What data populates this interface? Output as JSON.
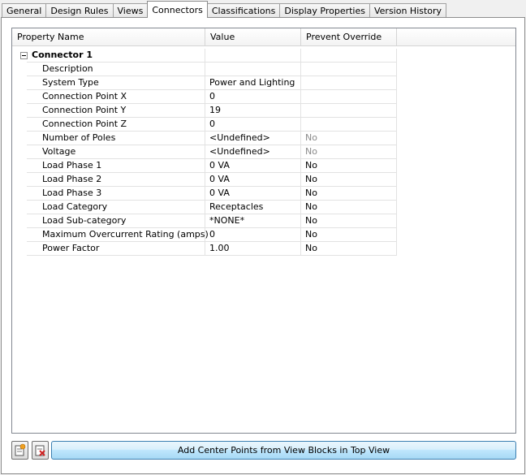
{
  "tabs": [
    {
      "label": "General"
    },
    {
      "label": "Design Rules"
    },
    {
      "label": "Views"
    },
    {
      "label": "Connectors",
      "active": true
    },
    {
      "label": "Classifications"
    },
    {
      "label": "Display Properties"
    },
    {
      "label": "Version History"
    }
  ],
  "grid": {
    "headers": {
      "property": "Property Name",
      "value": "Value",
      "override": "Prevent Override"
    },
    "group_label": "Connector 1",
    "rows": [
      {
        "name": "Description",
        "value": "",
        "override": ""
      },
      {
        "name": "System Type",
        "value": "Power and Lighting",
        "override": ""
      },
      {
        "name": "Connection Point X",
        "value": "0",
        "override": ""
      },
      {
        "name": "Connection Point Y",
        "value": "19",
        "override": ""
      },
      {
        "name": "Connection Point Z",
        "value": "0",
        "override": ""
      },
      {
        "name": "Number of Poles",
        "value": "<Undefined>",
        "override": "No",
        "override_disabled": true
      },
      {
        "name": "Voltage",
        "value": "<Undefined>",
        "override": "No",
        "override_disabled": true
      },
      {
        "name": "Load Phase 1",
        "value": "0 VA",
        "override": "No"
      },
      {
        "name": "Load Phase 2",
        "value": "0 VA",
        "override": "No"
      },
      {
        "name": "Load Phase 3",
        "value": "0 VA",
        "override": "No"
      },
      {
        "name": "Load Category",
        "value": "Receptacles",
        "override": "No"
      },
      {
        "name": "Load Sub-category",
        "value": "*NONE*",
        "override": "No"
      },
      {
        "name": "Maximum Overcurrent Rating (amps)",
        "value": "0",
        "override": "No"
      },
      {
        "name": "Power Factor",
        "value": "1.00",
        "override": "No"
      }
    ]
  },
  "footer": {
    "add_button_icon": "add-connector-icon",
    "remove_button_icon": "remove-connector-icon",
    "center_points_label": "Add Center Points from View Blocks in Top View"
  }
}
